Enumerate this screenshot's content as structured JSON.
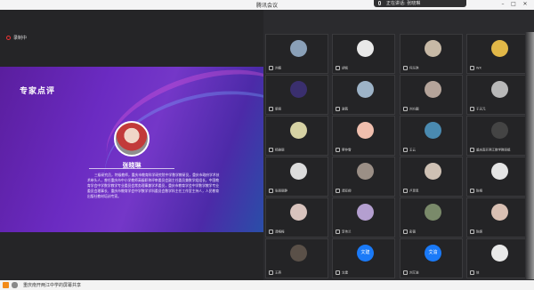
{
  "window": {
    "title": "腾讯会议",
    "speaking_label": "正在讲话: 张晓琳"
  },
  "recording": {
    "label": "录制中"
  },
  "slide": {
    "heading": "专家点评",
    "name": "张晓琳",
    "bio": "三级研究员，特级教师，重庆市教育科学研究院中学数学教研员，重庆市政府学术技术带头人，曾任重庆市中小学教师高级职称评审委员会副主任委员兼数学组组长，中国教育学会中学数学教学专业委员会常务理事兼学术委员，重庆市教育学会中学数学教学专业委员会理事长、重庆市教育学会中学数学学科委员会数学科主任工作室主持人，人民教育出版社教材培训专家。"
  },
  "bottom_bar": {
    "message": "重庆南开两江中学的屏幕共享"
  },
  "participants": [
    {
      "name": "刘楠",
      "avatar": "photo",
      "color": "#8aa0b8"
    },
    {
      "name": "胡铭",
      "avatar": "photo",
      "color": "#e9e9e9"
    },
    {
      "name": "何乐琪",
      "avatar": "photo",
      "color": "#c7b9a6"
    },
    {
      "name": "WX",
      "avatar": "photo",
      "color": "#e2b848"
    },
    {
      "name": "梁丽",
      "avatar": "photo",
      "color": "#3a2f6e"
    },
    {
      "name": "谢茜",
      "avatar": "photo",
      "color": "#9db3c7"
    },
    {
      "name": "刘方圆",
      "avatar": "photo",
      "color": "#b5a49a"
    },
    {
      "name": "于天元",
      "avatar": "photo",
      "color": "#b8b8b8"
    },
    {
      "name": "杨雅丽",
      "avatar": "photo",
      "color": "#d6d2a4"
    },
    {
      "name": "蔡仲雪",
      "avatar": "photo",
      "color": "#f0bfae"
    },
    {
      "name": "王云",
      "avatar": "photo",
      "color": "#4a8ab0"
    },
    {
      "name": "重庆南开两江数学教研组",
      "avatar": "photo",
      "color": "#444"
    },
    {
      "name": "张丽丽静",
      "avatar": "photo",
      "color": "#dcdcdc"
    },
    {
      "name": "谭亚卿",
      "avatar": "photo",
      "color": "#9b8f86"
    },
    {
      "name": "卢思思",
      "avatar": "photo",
      "color": "#cfc1b4"
    },
    {
      "name": "陈桐",
      "avatar": "photo",
      "color": "#e5e5e5"
    },
    {
      "name": "谭梅梅",
      "avatar": "photo",
      "color": "#d8c3bd"
    },
    {
      "name": "李伟兰",
      "avatar": "photo",
      "color": "#b49fd0"
    },
    {
      "name": "彭薇",
      "avatar": "photo",
      "color": "#7a8a6a"
    },
    {
      "name": "陈嬿",
      "avatar": "photo",
      "color": "#d9c0b3"
    },
    {
      "name": "王燕",
      "avatar": "photo",
      "color": "#5a5048"
    },
    {
      "name": "文建",
      "avatar": "text",
      "text": "文建",
      "color": "#1a7af8"
    },
    {
      "name": "刘艾渝",
      "avatar": "text",
      "text": "艾渝",
      "color": "#1a7af8"
    },
    {
      "name": "信",
      "avatar": "photo",
      "color": "#e9e9e9"
    }
  ]
}
